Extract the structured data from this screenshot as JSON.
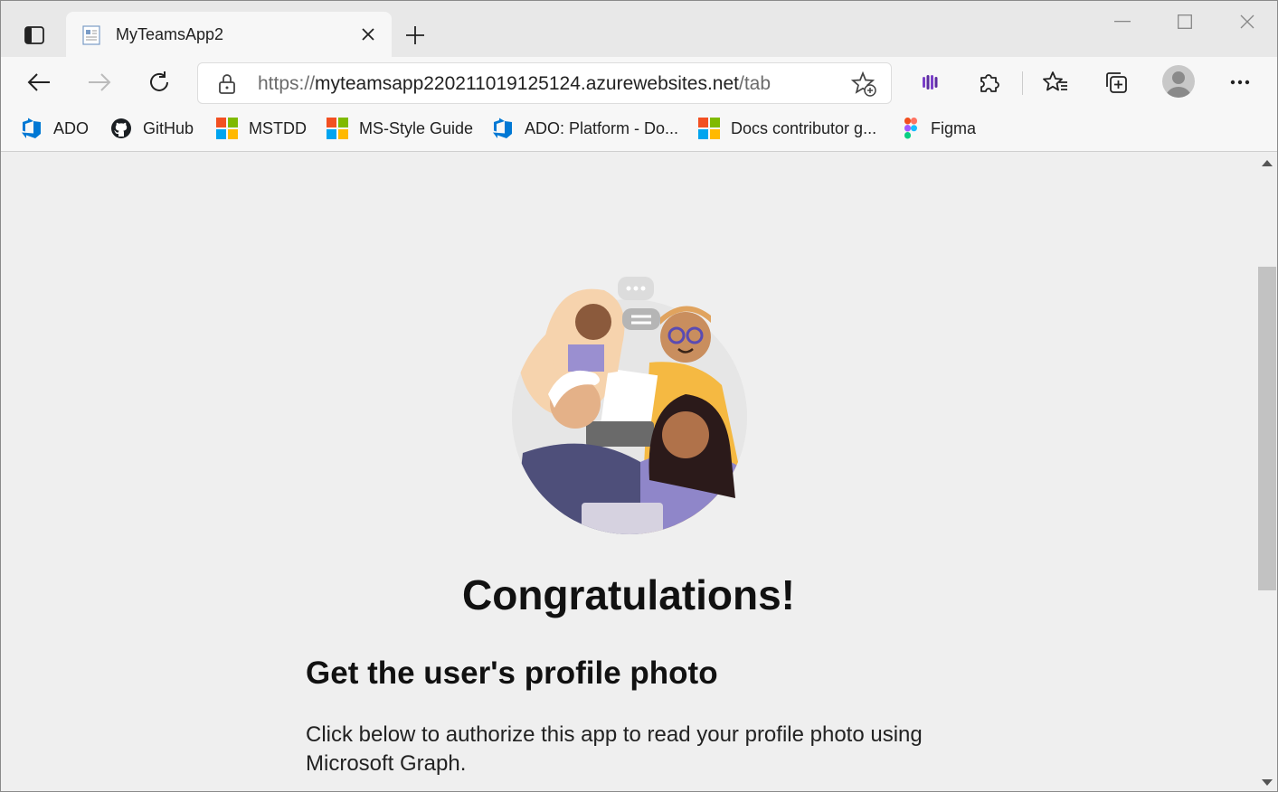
{
  "browser": {
    "tab": {
      "title": "MyTeamsApp2",
      "icon": "page-icon"
    },
    "new_tab_icon": "plus-icon",
    "window_controls": [
      "minimize-icon",
      "maximize-icon",
      "close-icon"
    ],
    "address": {
      "scheme": "https://",
      "host": "myteamsapp220211019125124.azurewebsites.net",
      "path": "/tab"
    },
    "toolbar_icons": [
      "back-icon",
      "forward-icon",
      "refresh-icon",
      "lock-icon",
      "add-favorite-icon",
      "extension-icon",
      "puzzle-icon",
      "favorites-icon",
      "collections-icon",
      "profile-avatar",
      "more-icon"
    ]
  },
  "favorites": [
    {
      "label": "ADO",
      "icon": "azure-devops-icon"
    },
    {
      "label": "GitHub",
      "icon": "github-icon"
    },
    {
      "label": "MSTDD",
      "icon": "microsoft-logo-icon"
    },
    {
      "label": "MS-Style Guide",
      "icon": "microsoft-logo-icon"
    },
    {
      "label": "ADO: Platform - Do...",
      "icon": "azure-devops-icon"
    },
    {
      "label": "Docs contributor g...",
      "icon": "microsoft-logo-icon"
    },
    {
      "label": "Figma",
      "icon": "figma-icon"
    }
  ],
  "page": {
    "hero_image": "team-collaboration-illustration",
    "title": "Congratulations!",
    "subtitle": "Get the user's profile photo",
    "paragraph": "Click below to authorize this app to read your profile photo using Microsoft Graph."
  },
  "colors": {
    "accent_ms_red": "#f25022",
    "accent_ms_green": "#7fba00",
    "accent_ms_blue": "#00a4ef",
    "accent_ms_yellow": "#ffb900",
    "ado_blue": "#0078d4"
  }
}
